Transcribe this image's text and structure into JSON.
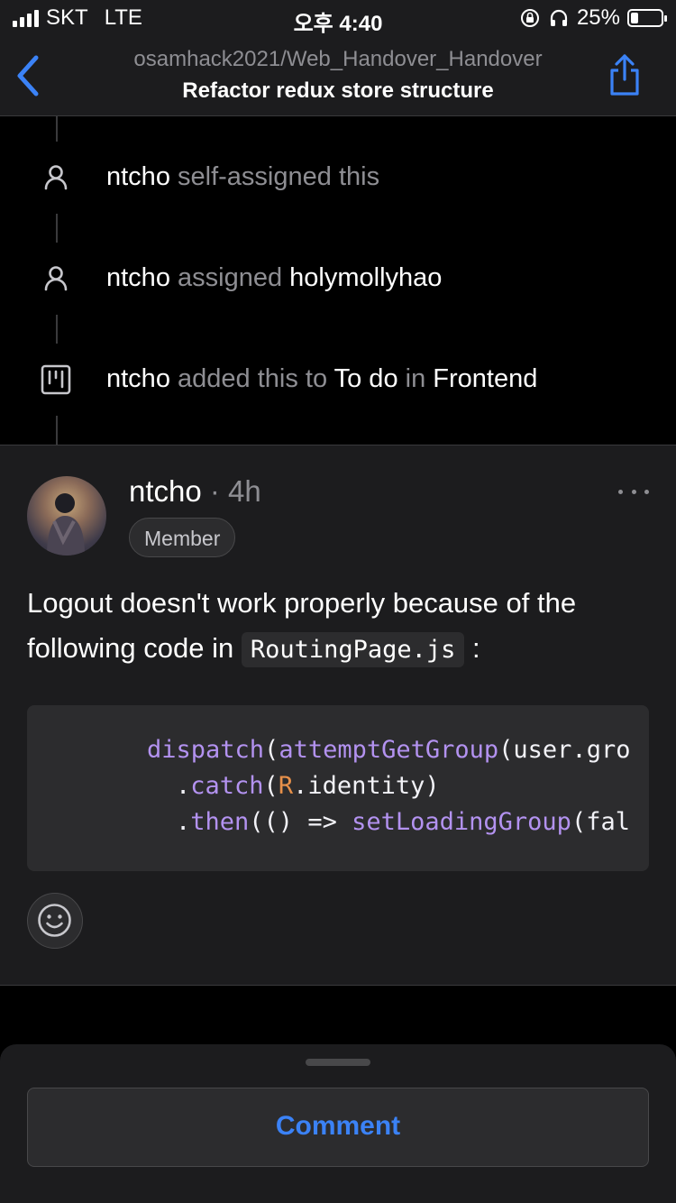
{
  "status_bar": {
    "carrier": "SKT",
    "network": "LTE",
    "time": "오후 4:40",
    "battery_percent_label": "25%",
    "battery_level": 0.25
  },
  "nav": {
    "repo": "osamhack2021/Web_Handover_Handover",
    "title": "Refactor redux store structure",
    "back_icon": "chevron-left-icon",
    "share_icon": "share-icon",
    "accent_color": "#3b82f6"
  },
  "timeline": [
    {
      "icon": "person-icon",
      "actor": "ntcho",
      "text": " self-assigned this",
      "target": "",
      "mid": "",
      "target2": ""
    },
    {
      "icon": "person-icon",
      "actor": "ntcho",
      "text": " assigned ",
      "target": "holymollyhao",
      "mid": "",
      "target2": ""
    },
    {
      "icon": "project-icon",
      "actor": "ntcho",
      "text": " added this to ",
      "target": "To do",
      "mid": " in ",
      "target2": "Frontend"
    }
  ],
  "comment": {
    "author": "ntcho",
    "time_ago": " · 4h",
    "badge": "Member",
    "body_before": "Logout doesn't work properly because of the following code in ",
    "body_code": "RoutingPage.js",
    "body_after": ":",
    "code": {
      "line1_fn1": "dispatch",
      "line1_p1": "(",
      "line1_fn2": "attemptGetGroup",
      "line1_rest": "(user.gro",
      "line2_dot": ".",
      "line2_fn": "catch",
      "line2_p": "(",
      "line2_r": "R",
      "line2_rest": ".identity)",
      "line3_dot": ".",
      "line3_fn": "then",
      "line3_mid": "(() => ",
      "line3_fn2": "setLoadingGroup",
      "line3_rest": "(fal"
    }
  },
  "bottom": {
    "comment_label": "Comment"
  }
}
